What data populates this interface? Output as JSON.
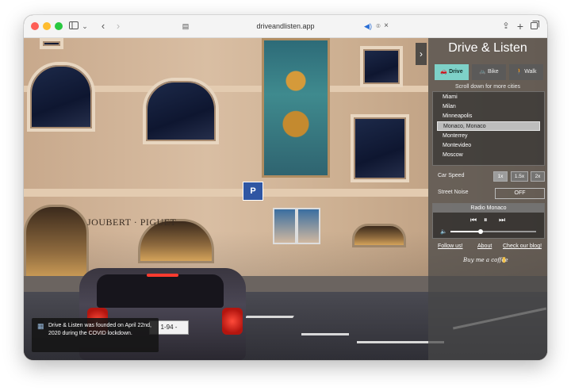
{
  "browser": {
    "url": "driveandlisten.app",
    "icons": [
      "sidebar-icon",
      "chevron-down-icon",
      "back-icon",
      "forward-icon",
      "reader-icon",
      "audio-icon",
      "close-tab-icon",
      "share-icon",
      "new-tab-icon",
      "tabs-overview-icon"
    ]
  },
  "scene": {
    "shop_sign": "JOUBERT · PIGUET",
    "plate": "1-94 -"
  },
  "panel": {
    "title": "Drive & Listen",
    "modes": [
      {
        "label": "Drive",
        "icon": "car-icon",
        "active": true
      },
      {
        "label": "Bike",
        "icon": "bike-icon",
        "active": false
      },
      {
        "label": "Walk",
        "icon": "walk-icon",
        "active": false
      }
    ],
    "scroll_hint": "Scroll down for more cities",
    "cities": [
      "Miami",
      "Milan",
      "Minneapolis",
      "Monaco, Monaco",
      "Monterrey",
      "Montevideo",
      "Moscow"
    ],
    "selected_city": "Monaco, Monaco",
    "car_speed_label": "Car Speed",
    "speeds": [
      "1x",
      "1.5x",
      "2x"
    ],
    "active_speed": "1x",
    "street_noise_label": "Street Noise",
    "street_noise_value": "OFF",
    "radio_title": "Radio Monaco",
    "volume": 0.35,
    "links": {
      "follow": "Follow us!",
      "about": "About",
      "blog": "Check our blog!"
    },
    "coffee": "Buy me a coffee"
  },
  "toast": {
    "text": "Drive & Listen was founded on April 22nd, 2020 during the COVID lockdown."
  },
  "colors": {
    "accent": "#7ed1c8",
    "panel_bg": "#464646"
  }
}
